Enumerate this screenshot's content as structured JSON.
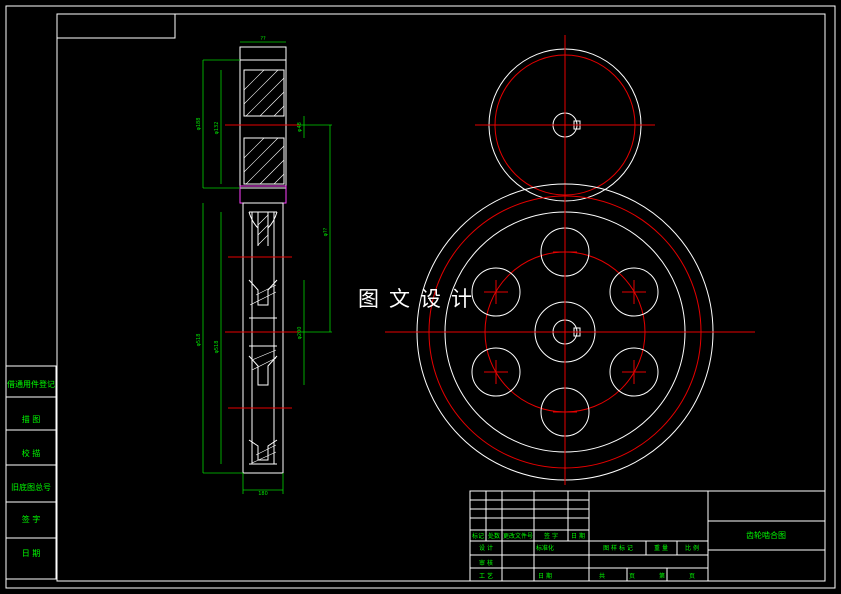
{
  "colors": {
    "background": "#000000",
    "outline": "#ffffff",
    "centerline": "#e60000",
    "dimension": "#00d200",
    "text": "#00ff00"
  },
  "watermark": "图文设计",
  "side_column": {
    "labels": [
      "借通用件登记",
      "描 图",
      "校 描",
      "旧底图总号",
      "签 字",
      "日 期"
    ]
  },
  "dimensions": {
    "width_top": "??",
    "gear_od": "φ188",
    "gear_pitch": "φ132",
    "gear_bore": "φ48",
    "center_distance": "φ??",
    "wheel_od": "φ518",
    "wheel_pitch": "φ518",
    "wheel_hub": "φ200",
    "width_bottom": "180"
  },
  "title_block": {
    "row1": [
      "标记",
      "处数",
      "更改文件号",
      "签 字",
      "日 期"
    ],
    "row2_left": "设 计",
    "row2_mid": "标准化",
    "row2_right": [
      "图 样 标 记",
      "重 量",
      "比 例"
    ],
    "row3_left": [
      "审 核",
      "工 艺"
    ],
    "row3_mid": "日 期",
    "row3_right": [
      "共",
      "页",
      "第",
      "页"
    ],
    "drawing_title": "齿轮啮合图"
  }
}
